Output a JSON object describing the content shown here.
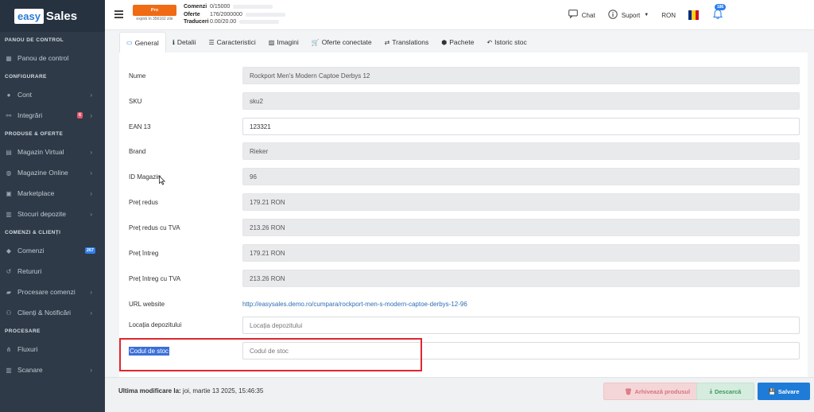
{
  "logo": {
    "easy": "easy",
    "sales": "Sales"
  },
  "sidebar": {
    "sections": [
      {
        "title": "PANOU DE CONTROL",
        "items": [
          {
            "label": "Panou de control",
            "icon": "dashboard-icon"
          }
        ]
      },
      {
        "title": "CONFIGURARE",
        "items": [
          {
            "label": "Cont",
            "icon": "user-icon",
            "chevron": true
          },
          {
            "label": "Integrări",
            "icon": "link-icon",
            "chevron": true,
            "badge": "6"
          }
        ]
      },
      {
        "title": "PRODUSE & OFERTE",
        "items": [
          {
            "label": "Magazin Virtual",
            "icon": "store-icon",
            "chevron": true
          },
          {
            "label": "Magazine Online",
            "icon": "globe-icon",
            "chevron": true
          },
          {
            "label": "Marketplace",
            "icon": "marketplace-icon",
            "chevron": true
          },
          {
            "label": "Stocuri depozite",
            "icon": "warehouse-icon",
            "chevron": true
          }
        ]
      },
      {
        "title": "COMENZI & CLIENȚI",
        "items": [
          {
            "label": "Comenzi",
            "icon": "tag-icon",
            "badge": "267"
          },
          {
            "label": "Retururi",
            "icon": "return-icon"
          },
          {
            "label": "Procesare comenzi",
            "icon": "truck-icon",
            "chevron": true
          },
          {
            "label": "Clienți & Notificări",
            "icon": "users-icon",
            "chevron": true
          }
        ]
      },
      {
        "title": "PROCESARE",
        "items": [
          {
            "label": "Fluxuri",
            "icon": "flow-icon"
          },
          {
            "label": "Scanare",
            "icon": "barcode-icon",
            "chevron": true
          }
        ]
      }
    ]
  },
  "topbar": {
    "plan": "Pro",
    "plan_expiry": "expiră în 356162 zile",
    "quota": [
      {
        "label": "Comenzi",
        "value": "0/15000"
      },
      {
        "label": "Oferte",
        "value": "176/2000000"
      },
      {
        "label": "Traduceri",
        "value": "0.00/20.00"
      }
    ],
    "chat": "Chat",
    "support": "Suport",
    "currency": "RON",
    "notifications": "186"
  },
  "tabs": [
    {
      "label": "General",
      "icon": "monitor-icon",
      "active": true
    },
    {
      "label": "Detalii",
      "icon": "info-icon"
    },
    {
      "label": "Caracteristici",
      "icon": "list-icon"
    },
    {
      "label": "Imagini",
      "icon": "image-icon"
    },
    {
      "label": "Oferte conectate",
      "icon": "cart-icon"
    },
    {
      "label": "Translations",
      "icon": "translate-icon"
    },
    {
      "label": "Pachete",
      "icon": "package-icon"
    },
    {
      "label": "Istoric stoc",
      "icon": "history-icon"
    }
  ],
  "form": {
    "fields": [
      {
        "label": "Nume",
        "value": "Rockport Men's Modern Captoe Derbys 12",
        "readonly": true
      },
      {
        "label": "SKU",
        "value": "sku2",
        "readonly": true
      },
      {
        "label": "EAN 13",
        "value": "123321",
        "readonly": false
      },
      {
        "label": "Brand",
        "value": "Rieker",
        "readonly": true
      },
      {
        "label": "ID Magazin",
        "value": "96",
        "readonly": true
      },
      {
        "label": "Preț redus",
        "value": "179.21 RON",
        "readonly": true
      },
      {
        "label": "Preț redus cu TVA",
        "value": "213.26 RON",
        "readonly": true
      },
      {
        "label": "Preț întreg",
        "value": "179.21 RON",
        "readonly": true
      },
      {
        "label": "Preț întreg cu TVA",
        "value": "213.26 RON",
        "readonly": true
      }
    ],
    "url_label": "URL website",
    "url_value": "http://easysales.demo.ro/cumpara/rockport-men-s-modern-captoe-derbys-12-96",
    "location_label": "Locația depozitului",
    "location_placeholder": "Locația depozitului",
    "stock_code_label": "Codul de stoc",
    "stock_code_placeholder": "Codul de stoc"
  },
  "footer": {
    "last_modified_label": "Ultima modificare la:",
    "last_modified_value": "joi, martie 13 2025, 15:46:35",
    "archive": "Arhivează produsul",
    "download": "Descarcă",
    "save": "Salvare"
  },
  "colors": {
    "accent": "#2f80ed",
    "sidebar": "#2e3a47",
    "plan": "#f06b14",
    "highlight": "#e0262e"
  }
}
